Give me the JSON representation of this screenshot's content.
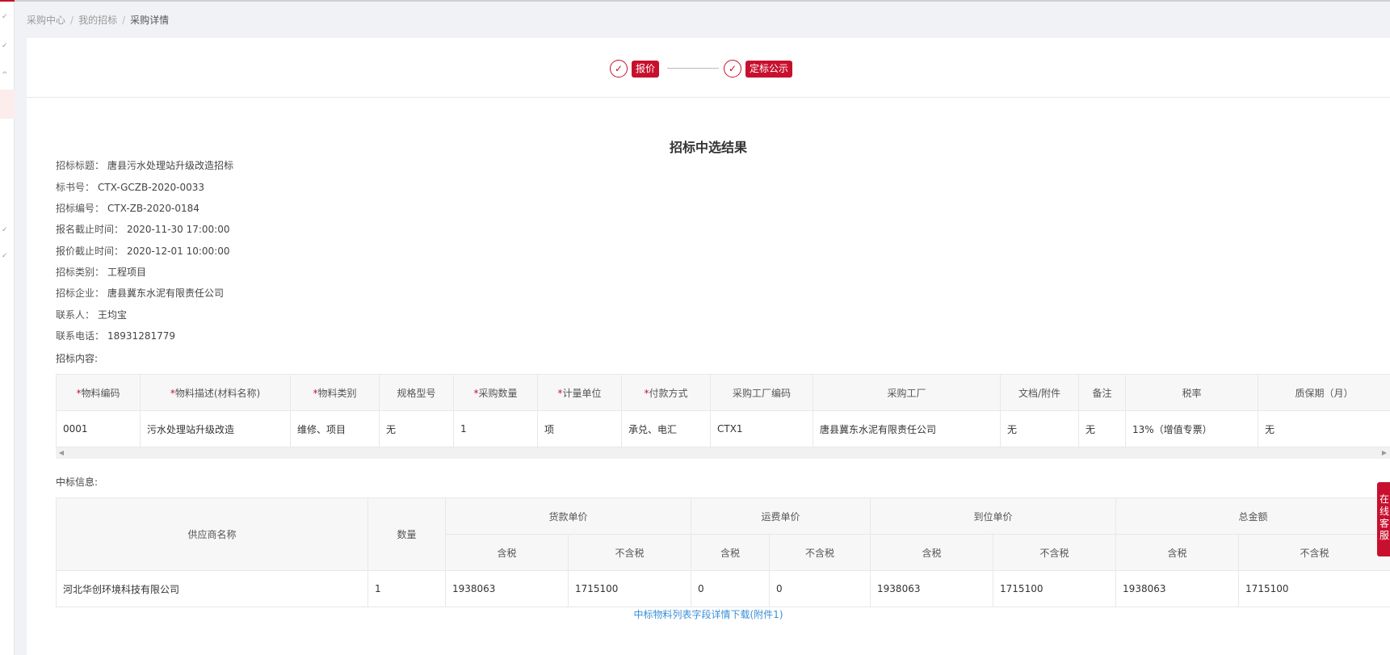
{
  "breadcrumb": {
    "items": [
      "采购中心",
      "我的招标"
    ],
    "current": "采购详情",
    "separator": "/"
  },
  "steps": [
    {
      "label": "报价",
      "icon": "check-circle-icon"
    },
    {
      "label": "定标公示",
      "icon": "check-circle-icon"
    }
  ],
  "result": {
    "title": "招标中选结果"
  },
  "info": [
    {
      "key": "招标标题：",
      "value": "唐县污水处理站升级改造招标"
    },
    {
      "key": "标书号：",
      "value": "CTX-GCZB-2020-0033"
    },
    {
      "key": "招标编号：",
      "value": "CTX-ZB-2020-0184"
    },
    {
      "key": "报名截止时间：",
      "value": "2020-11-30 17:00:00"
    },
    {
      "key": "报价截止时间：",
      "value": "2020-12-01 10:00:00"
    },
    {
      "key": "招标类别：",
      "value": "工程项目"
    },
    {
      "key": "招标企业：",
      "value": "唐县冀东水泥有限责任公司"
    },
    {
      "key": "联系人：",
      "value": "王均宝"
    },
    {
      "key": "联系电话：",
      "value": "18931281779"
    }
  ],
  "content_label": "招标内容:",
  "content_table": {
    "headers": [
      "物料编码",
      "物料描述(材料名称)",
      "物料类别",
      "规格型号",
      "采购数量",
      "计量单位",
      "付款方式",
      "采购工厂编码",
      "采购工厂",
      "文档/附件",
      "备注",
      "税率",
      "质保期（月）"
    ],
    "required": [
      "*",
      "*",
      "*",
      "",
      "*",
      "*",
      "*",
      "",
      "",
      "",
      "",
      "",
      ""
    ],
    "rows": [
      [
        "0001",
        "污水处理站升级改造",
        "维修、项目",
        "无",
        "1",
        "项",
        "承兑、电汇",
        "CTX1",
        "唐县冀东水泥有限责任公司",
        "无",
        "无",
        "13%（增值专票）",
        "无"
      ]
    ]
  },
  "win_label": "中标信息:",
  "win_table": {
    "supplier_header": "供应商名称",
    "qty_header": "数量",
    "groups": [
      "货款单价",
      "运费单价",
      "到位单价",
      "总金额"
    ],
    "sub_headers": [
      "含税",
      "不含税"
    ],
    "row": {
      "supplier": "河北华创环境科技有限公司",
      "qty": "1",
      "goods_tax": "1938063",
      "goods_notax": "1715100",
      "freight_tax": "0",
      "freight_notax": "0",
      "arrive_tax": "1938063",
      "arrive_notax": "1715100",
      "total_tax": "1938063",
      "total_notax": "1715100"
    }
  },
  "download_link": "中标物料列表字段详情下载(附件1)",
  "service_tab": "在线客服",
  "colors": {
    "accent": "#c8102e",
    "link": "#3a8fd8"
  }
}
